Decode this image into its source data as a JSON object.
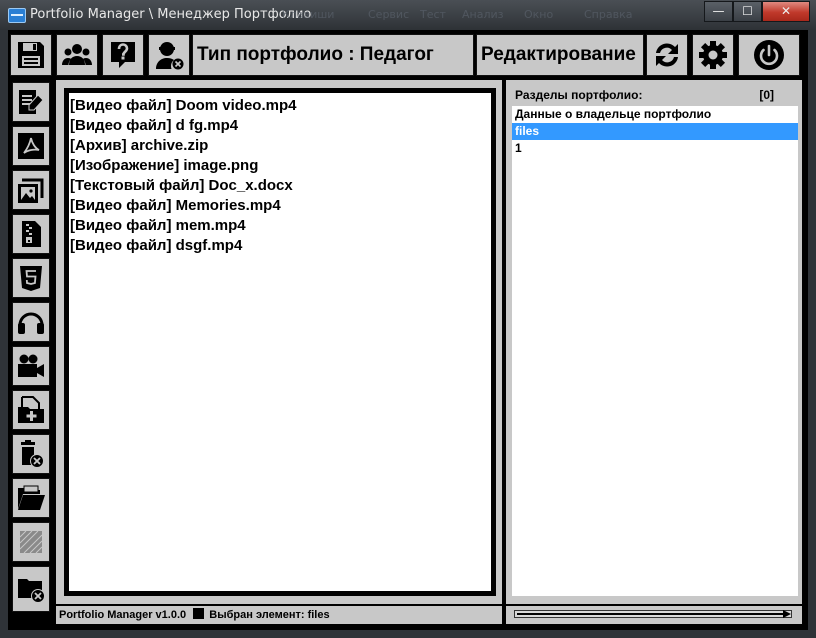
{
  "window": {
    "title": "Portfolio Manager \\ Менеджер Портфолио",
    "ghost_menu": [
      "Клавиши",
      "Сервис",
      "Тест",
      "Анализ",
      "Окно",
      "Справка"
    ],
    "controls": {
      "minimize": "—",
      "maximize": "☐",
      "close": "✕"
    }
  },
  "toolbar": {
    "portfolio_type": "Тип портфолио : Педагог",
    "mode": "Редактирование"
  },
  "sidebar_icons": [
    "save-icon",
    "edit-document-icon",
    "pdf-icon",
    "images-icon",
    "archive-icon",
    "html5-icon",
    "headphones-icon",
    "video-camera-icon",
    "add-file-icon",
    "delete-file-icon",
    "open-folder-icon",
    "disabled-icon",
    "delete-folder-icon"
  ],
  "files": [
    "[Видео файл] Doom video.mp4",
    "[Видео файл] d fg.mp4",
    "[Архив] archive.zip",
    "[Изображение] image.png",
    "[Текстовый файл] Doc_x.docx",
    "[Видео файл] Memories.mp4",
    "[Видео файл] mem.mp4",
    "[Видео файл] dsgf.mp4"
  ],
  "sections": {
    "header": "Разделы портфолио:",
    "count": "[0]",
    "items": [
      {
        "label": "Данные о владельце портфолио",
        "selected": false
      },
      {
        "label": "files",
        "selected": true
      },
      {
        "label": "1",
        "selected": false
      }
    ]
  },
  "status": {
    "version": "Portfolio Manager  v1.0.0",
    "selected": "Выбран элемент: files"
  },
  "colors": {
    "selection": "#3399ff",
    "panel": "#c8c8c8",
    "frame": "#000000"
  }
}
